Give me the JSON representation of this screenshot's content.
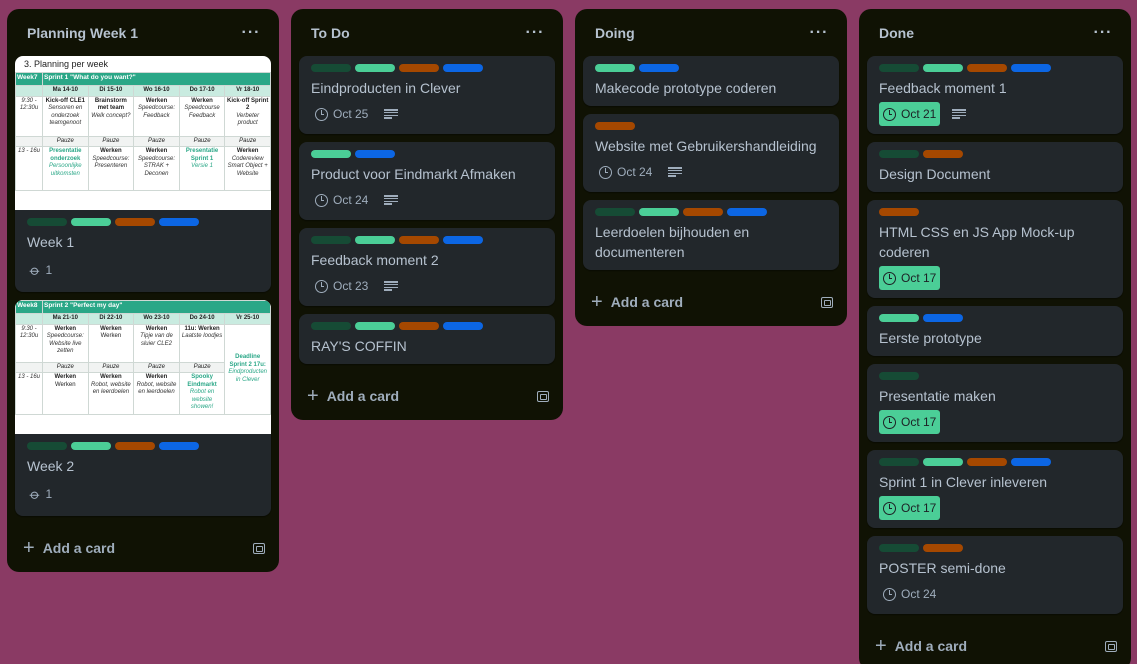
{
  "lists": [
    {
      "title": "Planning Week 1",
      "add_label": "Add a card",
      "cards": [
        {
          "title": "Week 1",
          "attachments": "1",
          "cover": {
            "heading": "3. Planning per week",
            "week": "Week7",
            "sprint": "Sprint 1 \"What do you want?\"",
            "days": [
              "Ma 14-10",
              "Di 15-10",
              "Wo 16-10",
              "Do 17-10",
              "Vr 18-10"
            ],
            "time1": "9:30 - 12:30u",
            "morning": [
              [
                "Kick-off CLE1",
                "Sensoren en onderzoek teamgenoot"
              ],
              [
                "Brainstorm met team",
                "Welk concept?"
              ],
              [
                "Werken",
                "Speedcourse: Feedback"
              ],
              [
                "Werken",
                "Speedcourse Feedback"
              ],
              [
                "Kick-off Sprint 2",
                "Verbeter product"
              ]
            ],
            "pauze": "Pauze",
            "time2": "13 - 16u",
            "afternoon": [
              [
                "Presentatie onderzoek",
                "Persoonlijke uitkomsten"
              ],
              [
                "Werken",
                "Speedcourse: Presenteren"
              ],
              [
                "Werken",
                "Speedcourse: STRAK + Deconen"
              ],
              [
                "Presentatie Sprint 1",
                "Versie 1"
              ],
              [
                "Werken",
                "Codereview Smart Object + Website"
              ]
            ]
          }
        },
        {
          "title": "Week 2",
          "attachments": "1",
          "cover": {
            "week": "Week8",
            "sprint": "Sprint 2 \"Perfect my day\"",
            "days": [
              "Ma 21-10",
              "Di 22-10",
              "Wo 23-10",
              "Do 24-10",
              "Vr 25-10"
            ],
            "time1": "9:30 - 12:30u",
            "morning": [
              [
                "Werken",
                "Speedcourse: Website live zetten"
              ],
              [
                "Werken",
                ""
              ],
              [
                "Werken",
                "Tipje van de sluier CLE2"
              ],
              [
                "11u: Werken",
                "Laatste loodjes"
              ]
            ],
            "friday": [
              "Deadline Sprint 2 17u:",
              "Eindproducten in Clever"
            ],
            "pauze": "Pauze",
            "time2": "13 - 16u",
            "afternoon": [
              [
                "Werken",
                "Werken"
              ],
              [
                "Werken",
                "Robot, website en leerdoelen"
              ],
              [
                "Werken",
                "Robot, website en leerdoelen"
              ],
              [
                "Spooky Eindmarkt",
                "Robot en website showen!"
              ]
            ]
          }
        }
      ]
    },
    {
      "title": "To Do",
      "add_label": "Add a card",
      "cards": [
        {
          "title": "Eindproducten in Clever",
          "date": "Oct 25"
        },
        {
          "title": "Product voor Eindmarkt Afmaken",
          "date": "Oct 24"
        },
        {
          "title": "Feedback moment 2",
          "date": "Oct 23"
        },
        {
          "title": "RAY'S COFFIN"
        }
      ]
    },
    {
      "title": "Doing",
      "add_label": "Add a card",
      "cards": [
        {
          "title": "Makecode prototype coderen"
        },
        {
          "title": "Website met Gebruikershandleiding",
          "date": "Oct 24"
        },
        {
          "title": "Leerdoelen bijhouden en documenteren"
        }
      ]
    },
    {
      "title": "Done",
      "add_label": "Add a card",
      "cards": [
        {
          "title": "Feedback moment 1",
          "date": "Oct 21"
        },
        {
          "title": "Design Document"
        },
        {
          "title": "HTML CSS en JS App Mock-up coderen",
          "date": "Oct 17"
        },
        {
          "title": "Eerste prototype"
        },
        {
          "title": "Presentatie maken",
          "date": "Oct 17"
        },
        {
          "title": "Sprint 1 in Clever inleveren",
          "date": "Oct 17"
        },
        {
          "title": "POSTER semi-done",
          "date": "Oct 24"
        }
      ]
    }
  ],
  "colors": {
    "background": "#8a3a64",
    "list": "#101204",
    "card": "#22272b",
    "label_dark_green": "#164b35",
    "label_green": "#4bce97",
    "label_orange": "#a54800",
    "label_blue": "#0c66e4"
  },
  "icons": [
    "more-icon",
    "clock-icon",
    "description-icon",
    "attachment-icon",
    "plus-icon",
    "template-icon"
  ]
}
